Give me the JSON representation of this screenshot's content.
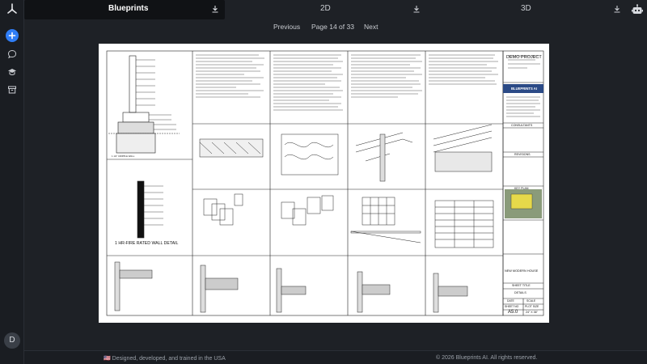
{
  "app": {
    "user_initial": "D"
  },
  "tabs": [
    {
      "label": "Blueprints",
      "active": true
    },
    {
      "label": "2D",
      "active": false
    },
    {
      "label": "3D",
      "active": false
    }
  ],
  "pager": {
    "previous": "Previous",
    "page": "Page 14 of 33",
    "next": "Next"
  },
  "sheet": {
    "project": "DEMO PROJECT",
    "brand": "BLUEPRINTS AI",
    "consultants": "CONSULTANTS",
    "revisions": "REVISIONS",
    "key_plan": "KEY PLAN",
    "job_title": "NEW MODERN HOUSE",
    "sheet_title_label": "SHEET TITLE",
    "sheet_title": "DETAILS",
    "date_label": "DATE",
    "scale_label": "SCALE",
    "sheet_no_label": "SHEET NO",
    "plot_size_label": "PLOT SIZE",
    "sheet_no": "A5.0",
    "plot_size": "24\" X 36\"",
    "detail_title": "1 HR-FIRE RATED WALL DETAIL"
  },
  "footer": {
    "left": "🇺🇸 Designed, developed, and trained in the USA",
    "right": "© 2026 Blueprints AI. All rights reserved."
  },
  "colors": {
    "accent": "#2f7df6",
    "background": "#1e2126",
    "sheet": "#ffffff"
  }
}
